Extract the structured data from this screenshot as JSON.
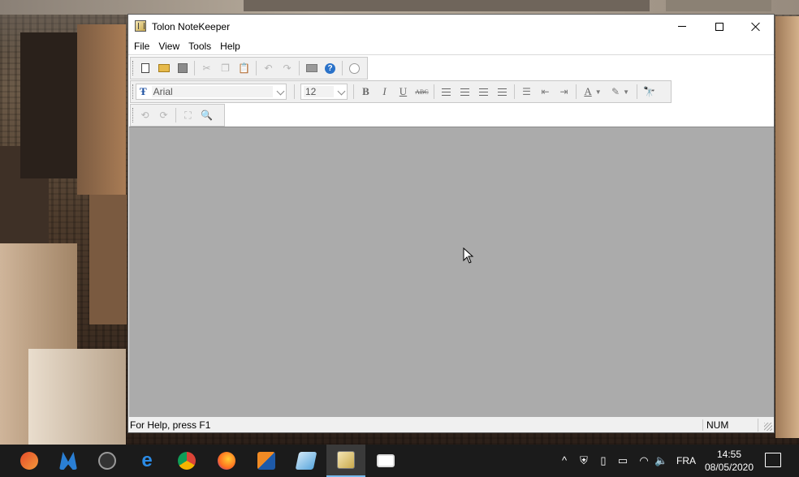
{
  "window": {
    "title": "Tolon NoteKeeper"
  },
  "menu": {
    "items": [
      "File",
      "View",
      "Tools",
      "Help"
    ]
  },
  "toolbar": {
    "font_name": "Arial",
    "font_size": "12",
    "format_buttons": [
      "B",
      "I",
      "U",
      "ABC"
    ]
  },
  "statusbar": {
    "help_text": "For Help, press F1",
    "num_indicator": "NUM"
  },
  "taskbar": {
    "language": "FRA",
    "time": "14:55",
    "date": "08/05/2020",
    "apps": [
      "ccleaner-icon",
      "malwarebytes-icon",
      "webcam-icon",
      "edge-icon",
      "chrome-icon",
      "firefox-icon",
      "sublime-icon",
      "notepad-icon",
      "notekeeper-icon",
      "remote-desktop-icon"
    ]
  },
  "colors": {
    "client_area": "#ababab",
    "taskbar": "#1b1b1b",
    "help_icon": "#2a72c9"
  }
}
